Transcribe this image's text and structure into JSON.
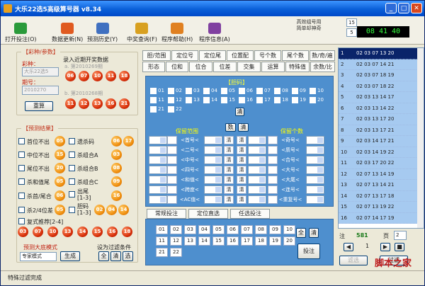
{
  "title": "大乐22选5高级算号器 v8.34",
  "toolbar": [
    {
      "label": "打开投注(O)",
      "icon": "folder-icon",
      "color": "#2a9a3a"
    },
    {
      "label": "数据更新(N)",
      "icon": "db-update-icon",
      "color": "#e05a20"
    },
    {
      "label": "预测历史(Y)",
      "icon": "history-icon",
      "color": "#4070c0"
    },
    {
      "label": "中奖查询(F)",
      "icon": "prize-icon",
      "color": "#d8a020"
    },
    {
      "label": "程序帮助(H)",
      "icon": "help-icon",
      "color": "#e08020"
    },
    {
      "label": "程序信息(A)",
      "icon": "info-icon",
      "color": "#8040a0"
    }
  ],
  "credit": {
    "line1": "高效组号用",
    "line2": "简单却神奇"
  },
  "counts": {
    "a": "15",
    "b": "5"
  },
  "clock": "08 41 40",
  "left": {
    "section_label": "【彩种/参数】",
    "recent_label": "录入近期开奖数据",
    "lottery_label": "彩种：",
    "lottery_value": "大乐22选5",
    "period_label": "期号：",
    "period_value": "2010270",
    "calc_btn": "重算",
    "a_label": "a. 第2010269期",
    "a_balls": [
      "06",
      "07",
      "10",
      "11",
      "18"
    ],
    "b_label": "b. 第2010268期",
    "b_balls": [
      "11",
      "12",
      "13",
      "16",
      "21"
    ]
  },
  "predict": {
    "section_label": "【预测结果】",
    "items": [
      {
        "label": "首位不出",
        "ball": "05"
      },
      {
        "label": "中位不出",
        "ball": "15"
      },
      {
        "label": "尾位不出",
        "ball": "20"
      },
      {
        "label": "杀和值尾",
        "ball": "05"
      },
      {
        "label": "杀首/尾合",
        "ball": "06"
      },
      {
        "label": "杀2/4位差",
        "ball": "05"
      }
    ],
    "right_items": [
      {
        "label": "遗杀码",
        "balls": [
          "06",
          "17"
        ]
      },
      {
        "label": "杀组合A",
        "balls": [
          "03"
        ]
      },
      {
        "label": "杀组合B",
        "balls": [
          "08"
        ]
      },
      {
        "label": "杀组合C",
        "balls": [
          "09"
        ]
      },
      {
        "label": "出尾\n[1-3]",
        "balls": [
          "16"
        ]
      },
      {
        "label": "胆码\n[1-3]",
        "balls": [
          "02",
          "04",
          "14",
          "16"
        ]
      }
    ],
    "compound_label": "复式推荐[2-4]",
    "compound_balls": [
      "03",
      "07",
      "10",
      "13",
      "14",
      "15",
      "16",
      "18"
    ],
    "mode_label": "预测大底模式",
    "mode_value": "专家模式",
    "gen_btn": "生成",
    "filter_label": "设为过滤条件",
    "filter_btns": [
      "全",
      "清",
      "选"
    ]
  },
  "tabs_row1": [
    "胆/范围",
    "定位号",
    "定位尾",
    "位置配",
    "号个数",
    "尾个数",
    "数/奇/遍"
  ],
  "tabs_row2": [
    "形态",
    "位和",
    "位合",
    "位差",
    "交集",
    "运算",
    "特殊值",
    "余数/比"
  ],
  "filter": {
    "section_label": "【胆码】",
    "nums": [
      "01",
      "02",
      "03",
      "04",
      "05",
      "06",
      "07",
      "08",
      "09",
      "10",
      "11",
      "12",
      "13",
      "14",
      "15",
      "16",
      "17",
      "18",
      "19",
      "20",
      "21",
      "22"
    ],
    "clear": "清",
    "range_label": "保留范围",
    "count_label": "保留个数",
    "numbtn": "数",
    "clearbtn": "清",
    "ops_left": [
      "<首号<",
      "<二号<",
      "<中号<",
      "<四号<",
      "<和值<",
      "<跨度<",
      "<AC值<"
    ],
    "ops_right": [
      "<奇号<",
      "<质号<",
      "<合号<",
      "<大号<",
      "<大尾<",
      "<连号<",
      "<重复号<"
    ],
    "clr": "清"
  },
  "bottom_tabs": [
    "常规投注",
    "定位直选",
    "任选投注"
  ],
  "bet_nums": [
    "01",
    "02",
    "03",
    "04",
    "05",
    "06",
    "07",
    "08",
    "09",
    "10",
    "11",
    "12",
    "13",
    "14",
    "15",
    "16",
    "17",
    "18",
    "19",
    "20",
    "21",
    "22"
  ],
  "bet": {
    "all": "全",
    "clear": "清",
    "submit": "投注"
  },
  "list": [
    {
      "n": "1",
      "v": "02 03 07 13 20"
    },
    {
      "n": "2",
      "v": "02 03 07 14 21"
    },
    {
      "n": "3",
      "v": "02 03 07 18 19"
    },
    {
      "n": "4",
      "v": "02 03 07 18 22"
    },
    {
      "n": "5",
      "v": "02 03 13 14 17"
    },
    {
      "n": "6",
      "v": "02 03 13 14 22"
    },
    {
      "n": "7",
      "v": "02 03 13 17 20"
    },
    {
      "n": "8",
      "v": "02 03 13 17 21"
    },
    {
      "n": "9",
      "v": "02 03 14 17 21"
    },
    {
      "n": "10",
      "v": "02 03 14 19 22"
    },
    {
      "n": "11",
      "v": "02 03 17 20 22"
    },
    {
      "n": "12",
      "v": "02 07 13 14 19"
    },
    {
      "n": "13",
      "v": "02 07 13 14 21"
    },
    {
      "n": "14",
      "v": "02 07 13 17 18"
    },
    {
      "n": "15",
      "v": "02 07 13 19 22"
    },
    {
      "n": "16",
      "v": "02 07 14 17 19"
    }
  ],
  "note": {
    "label": "注",
    "value": "581",
    "page_label": "页",
    "page_value": "2",
    "page_cur": "1"
  },
  "actions": {
    "cut": "滤选",
    "filter": "过滤"
  },
  "status": "特殊过滤完成",
  "watermark": "脚本之家"
}
